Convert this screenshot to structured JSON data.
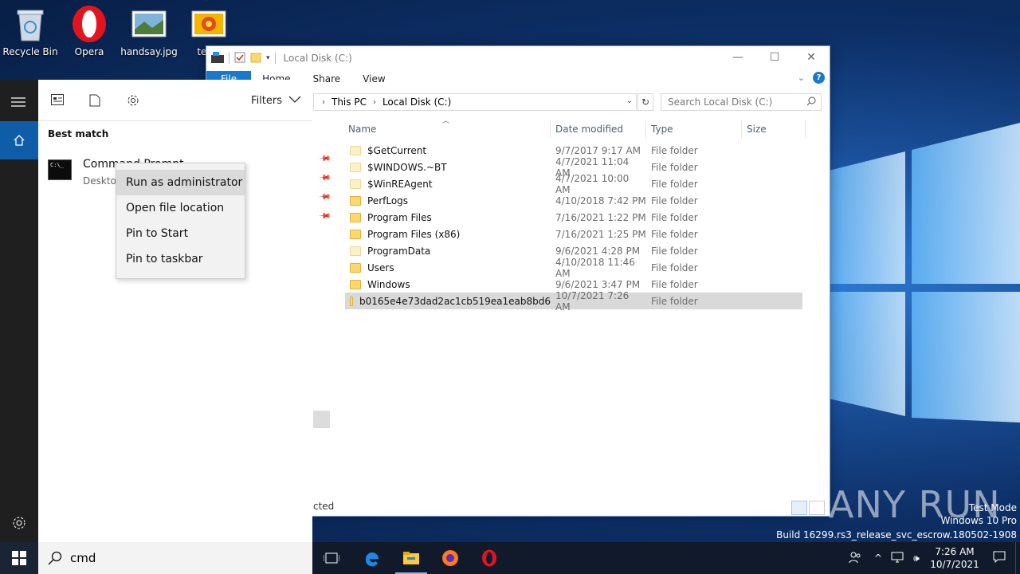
{
  "desktop": {
    "icons": [
      {
        "label": "Recycle Bin",
        "icon": "recycle-bin-icon"
      },
      {
        "label": "Opera",
        "icon": "opera-icon"
      },
      {
        "label": "handsay.jpg",
        "icon": "image-file-icon"
      },
      {
        "label": "tests",
        "icon": "image-file-icon"
      }
    ],
    "watermark": {
      "line1": "Test Mode",
      "line2": "Windows 10 Pro",
      "line3": "Build 16299.rs3_release_svc_escrow.180502-1908",
      "brand": "ANY RUN"
    }
  },
  "explorer": {
    "title": "Local Disk (C:)",
    "tabs": [
      "File",
      "Home",
      "Share",
      "View"
    ],
    "address": {
      "segments": [
        "This PC",
        "Local Disk (C:)"
      ]
    },
    "search_placeholder": "Search Local Disk (C:)",
    "columns": [
      "Name",
      "Date modified",
      "Type",
      "Size"
    ],
    "rows": [
      {
        "name": "$GetCurrent",
        "date": "9/7/2017 9:17 AM",
        "type": "File folder",
        "light": true
      },
      {
        "name": "$WINDOWS.~BT",
        "date": "4/7/2021 11:04 AM",
        "type": "File folder",
        "light": true
      },
      {
        "name": "$WinREAgent",
        "date": "4/7/2021 10:00 AM",
        "type": "File folder",
        "light": true
      },
      {
        "name": "PerfLogs",
        "date": "4/10/2018 7:42 PM",
        "type": "File folder",
        "light": false
      },
      {
        "name": "Program Files",
        "date": "7/16/2021 1:22 PM",
        "type": "File folder",
        "light": false
      },
      {
        "name": "Program Files (x86)",
        "date": "7/16/2021 1:25 PM",
        "type": "File folder",
        "light": false
      },
      {
        "name": "ProgramData",
        "date": "9/6/2021 4:28 PM",
        "type": "File folder",
        "light": true
      },
      {
        "name": "Users",
        "date": "4/10/2018 11:46 AM",
        "type": "File folder",
        "light": false
      },
      {
        "name": "Windows",
        "date": "9/6/2021 3:47 PM",
        "type": "File folder",
        "light": false
      },
      {
        "name": "b0165e4e73dad2ac1cb519ea1eab8bd6",
        "date": "10/7/2021 7:26 AM",
        "type": "File folder",
        "light": false,
        "selected": true
      }
    ],
    "status_text": "cted"
  },
  "start_menu": {
    "filters_label": "Filters",
    "best_match_label": "Best match",
    "result": {
      "title": "Command Prompt",
      "subtitle": "Desktop app"
    },
    "context_menu": [
      "Run as administrator",
      "Open file location",
      "Pin to Start",
      "Pin to taskbar"
    ]
  },
  "taskbar": {
    "search_text": "cmd",
    "clock_time": "7:26 AM",
    "clock_date": "10/7/2021"
  }
}
